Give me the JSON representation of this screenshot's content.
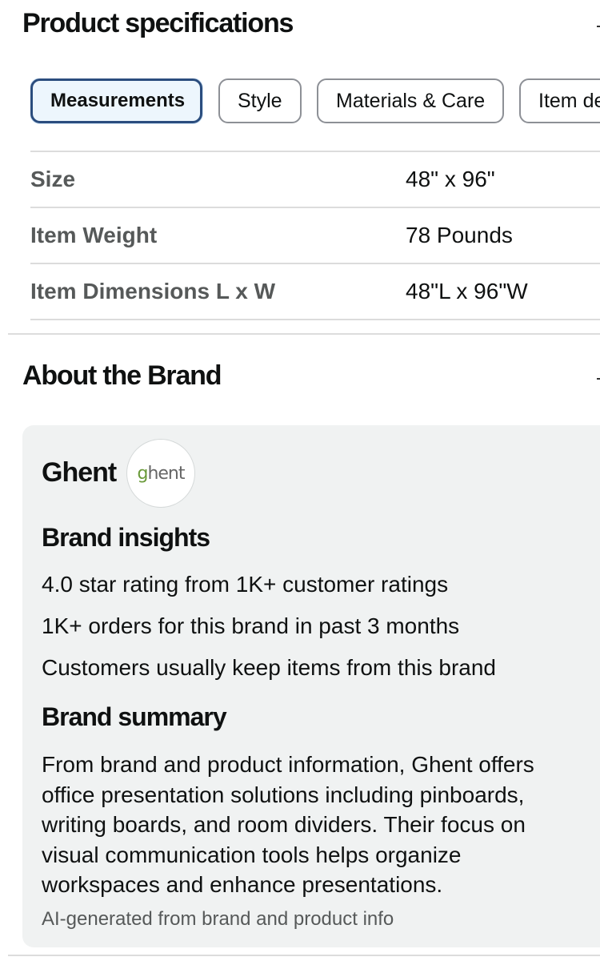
{
  "product_specifications": {
    "title": "Product specifications",
    "tabs": [
      {
        "label": "Measurements",
        "active": true
      },
      {
        "label": "Style",
        "active": false
      },
      {
        "label": "Materials & Care",
        "active": false
      },
      {
        "label": "Item de",
        "active": false
      }
    ],
    "rows": [
      {
        "label": "Size",
        "value": "48\" x 96\""
      },
      {
        "label": "Item Weight",
        "value": "78 Pounds"
      },
      {
        "label": "Item Dimensions L x W",
        "value": "48\"L x 96\"W"
      }
    ]
  },
  "about_brand": {
    "title": "About the Brand",
    "brand_name": "Ghent",
    "logo": {
      "first_letter": "g",
      "rest": "hent"
    },
    "insights_heading": "Brand insights",
    "insights": [
      "4.0 star rating from 1K+ customer ratings",
      "1K+ orders for this brand in past 3 months",
      "Customers usually keep items from this brand"
    ],
    "summary_heading": "Brand summary",
    "summary": "From brand and product information, Ghent offers office presentation solutions including pinboards, writing boards, and room dividers. Their focus on visual communication tools helps organize workspaces and enhance presentations.",
    "ai_note": "AI-generated from brand and product info"
  },
  "colors": {
    "active_tab_border": "#2b4d7e",
    "active_tab_bg": "#edf6fd",
    "card_bg": "#f0f2f2",
    "label_gray": "#565959",
    "logo_green": "#6a9a3a"
  }
}
